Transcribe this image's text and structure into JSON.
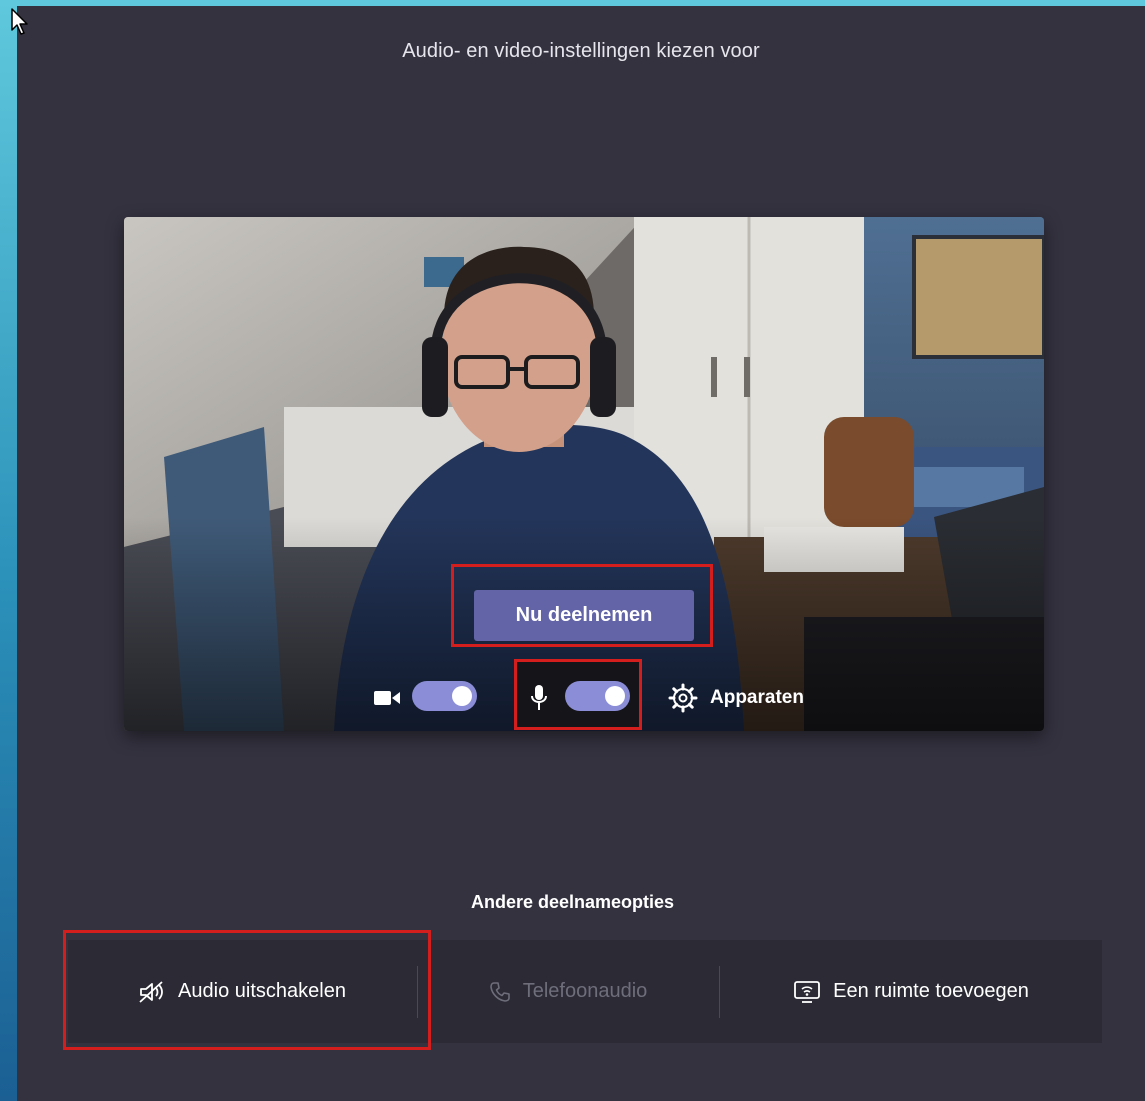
{
  "header": {
    "title": "Audio- en video-instellingen kiezen voor"
  },
  "preview": {
    "join_label": "Nu deelnemen",
    "video_enabled": true,
    "audio_enabled": true,
    "devices_label": "Apparaten"
  },
  "other_options": {
    "heading": "Andere deelnameopties",
    "items": [
      {
        "label": "Audio uitschakelen",
        "icon": "speaker-off-icon",
        "enabled": true
      },
      {
        "label": "Telefoonaudio",
        "icon": "phone-icon",
        "enabled": false
      },
      {
        "label": "Een ruimte toevoegen",
        "icon": "cast-screen-icon",
        "enabled": true
      }
    ]
  },
  "colors": {
    "accent": "#6264a7",
    "toggle_on": "#8b8dd6",
    "highlight": "#d41e1e",
    "background": "#34323f"
  }
}
